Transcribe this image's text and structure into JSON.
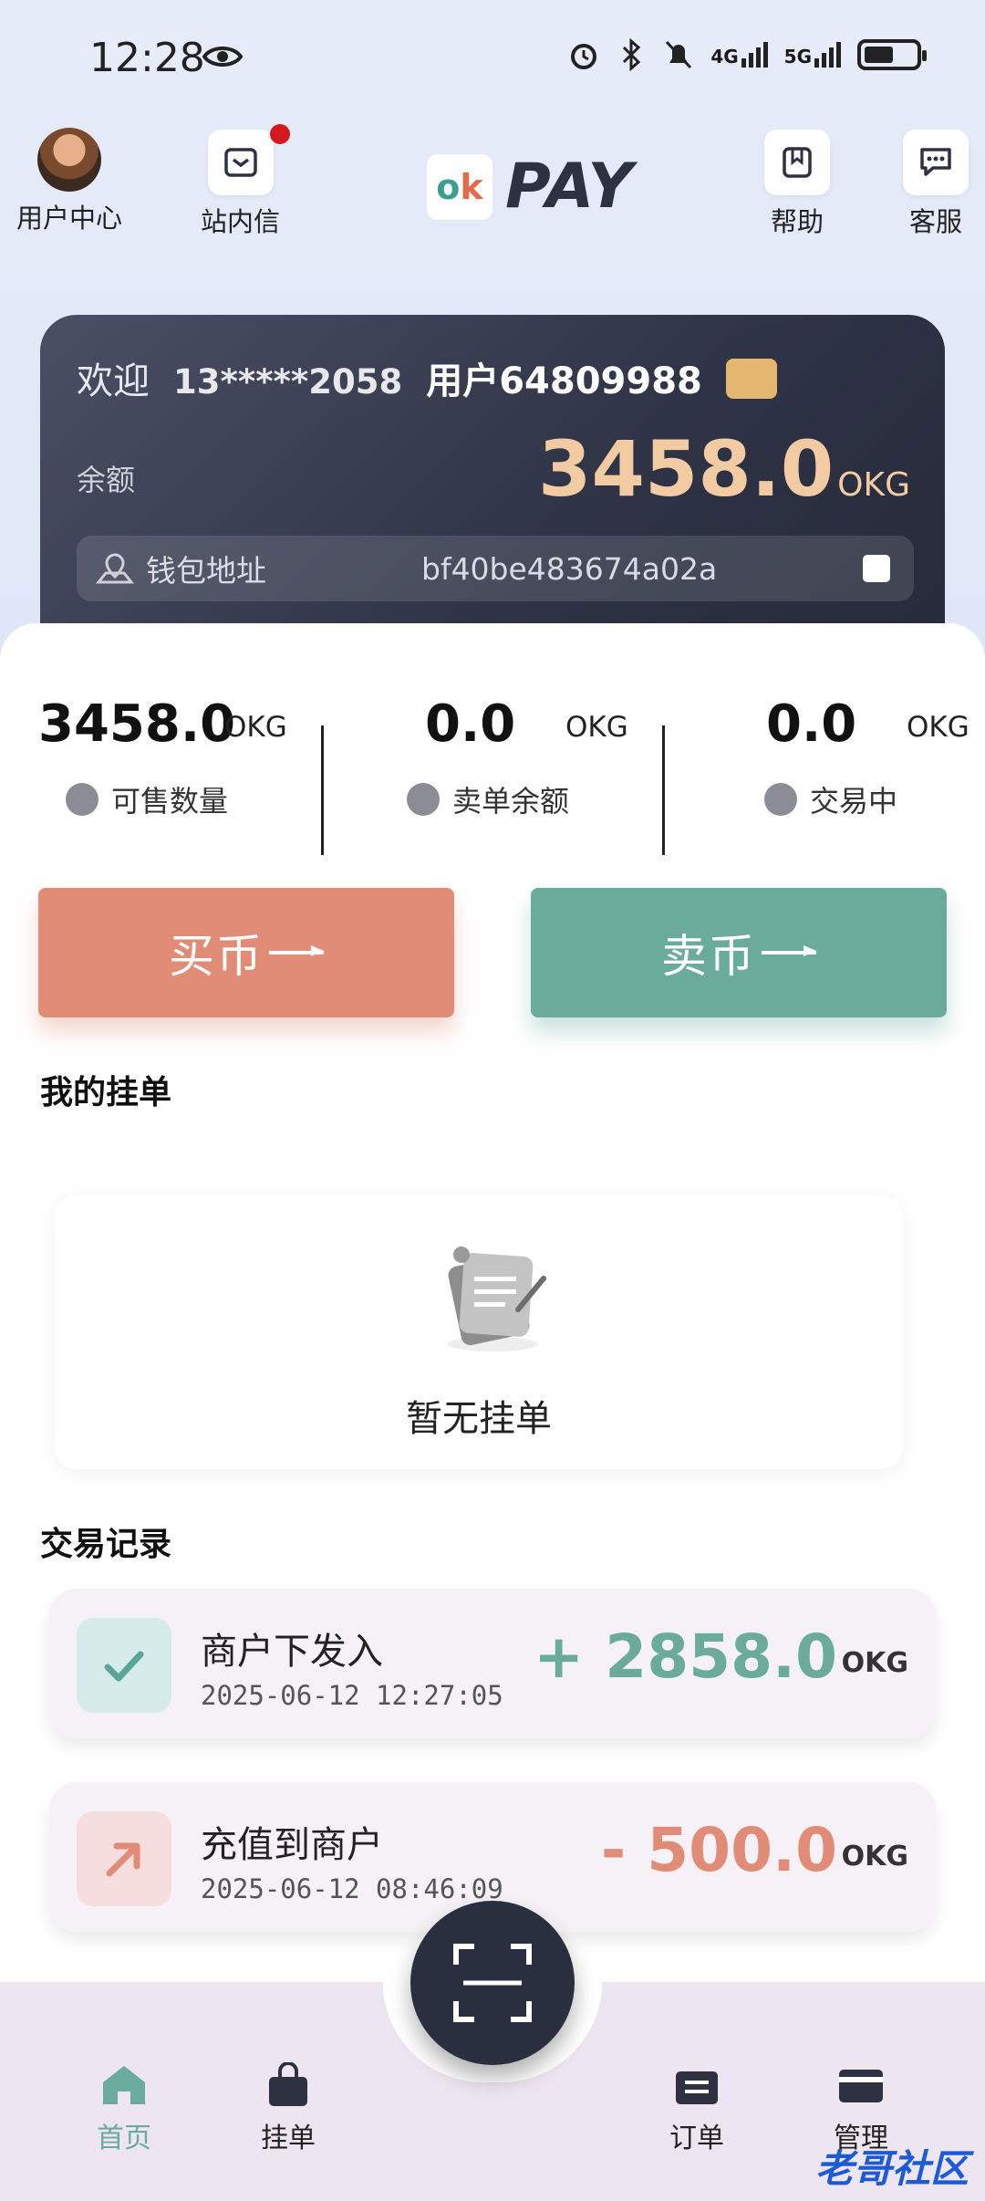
{
  "status_bar": {
    "time": "12:28",
    "net1": "4G",
    "net2": "5G"
  },
  "header": {
    "user_center": "用户中心",
    "inbox": "站内信",
    "logo_mark": "ok",
    "logo_text": "PAY",
    "help": "帮助",
    "service": "客服"
  },
  "card": {
    "welcome": "欢迎",
    "phone": "13*****2058",
    "username": "用户64809988",
    "balance_label": "余额",
    "balance": "3458.0",
    "unit": "OKG",
    "address_label": "钱包地址",
    "address": "bf40be483674a02a"
  },
  "stats": [
    {
      "value": "3458.0",
      "unit": "OKG",
      "label": "可售数量"
    },
    {
      "value": "0.0",
      "unit": "OKG",
      "label": "卖单余额"
    },
    {
      "value": "0.0",
      "unit": "OKG",
      "label": "交易中"
    }
  ],
  "actions": {
    "buy": "买币",
    "sell": "卖币"
  },
  "my_orders": {
    "title": "我的挂单",
    "empty": "暂无挂单"
  },
  "records": {
    "title": "交易记录",
    "items": [
      {
        "title": "商户下发入",
        "date": "2025-06-12 12:27:05",
        "amount": "+ 2858.0",
        "unit": "OKG"
      },
      {
        "title": "充值到商户",
        "date": "2025-06-12 08:46:09",
        "amount": "- 500.0",
        "unit": "OKG"
      }
    ]
  },
  "nav": {
    "home": "首页",
    "listings": "挂单",
    "orders": "订单",
    "manage": "管理"
  },
  "watermark": "老哥社区",
  "colors": {
    "buy": "#e08c76",
    "sell": "#6aab9c",
    "active_nav": "#6aab9c",
    "balance": "#f3cba2"
  }
}
